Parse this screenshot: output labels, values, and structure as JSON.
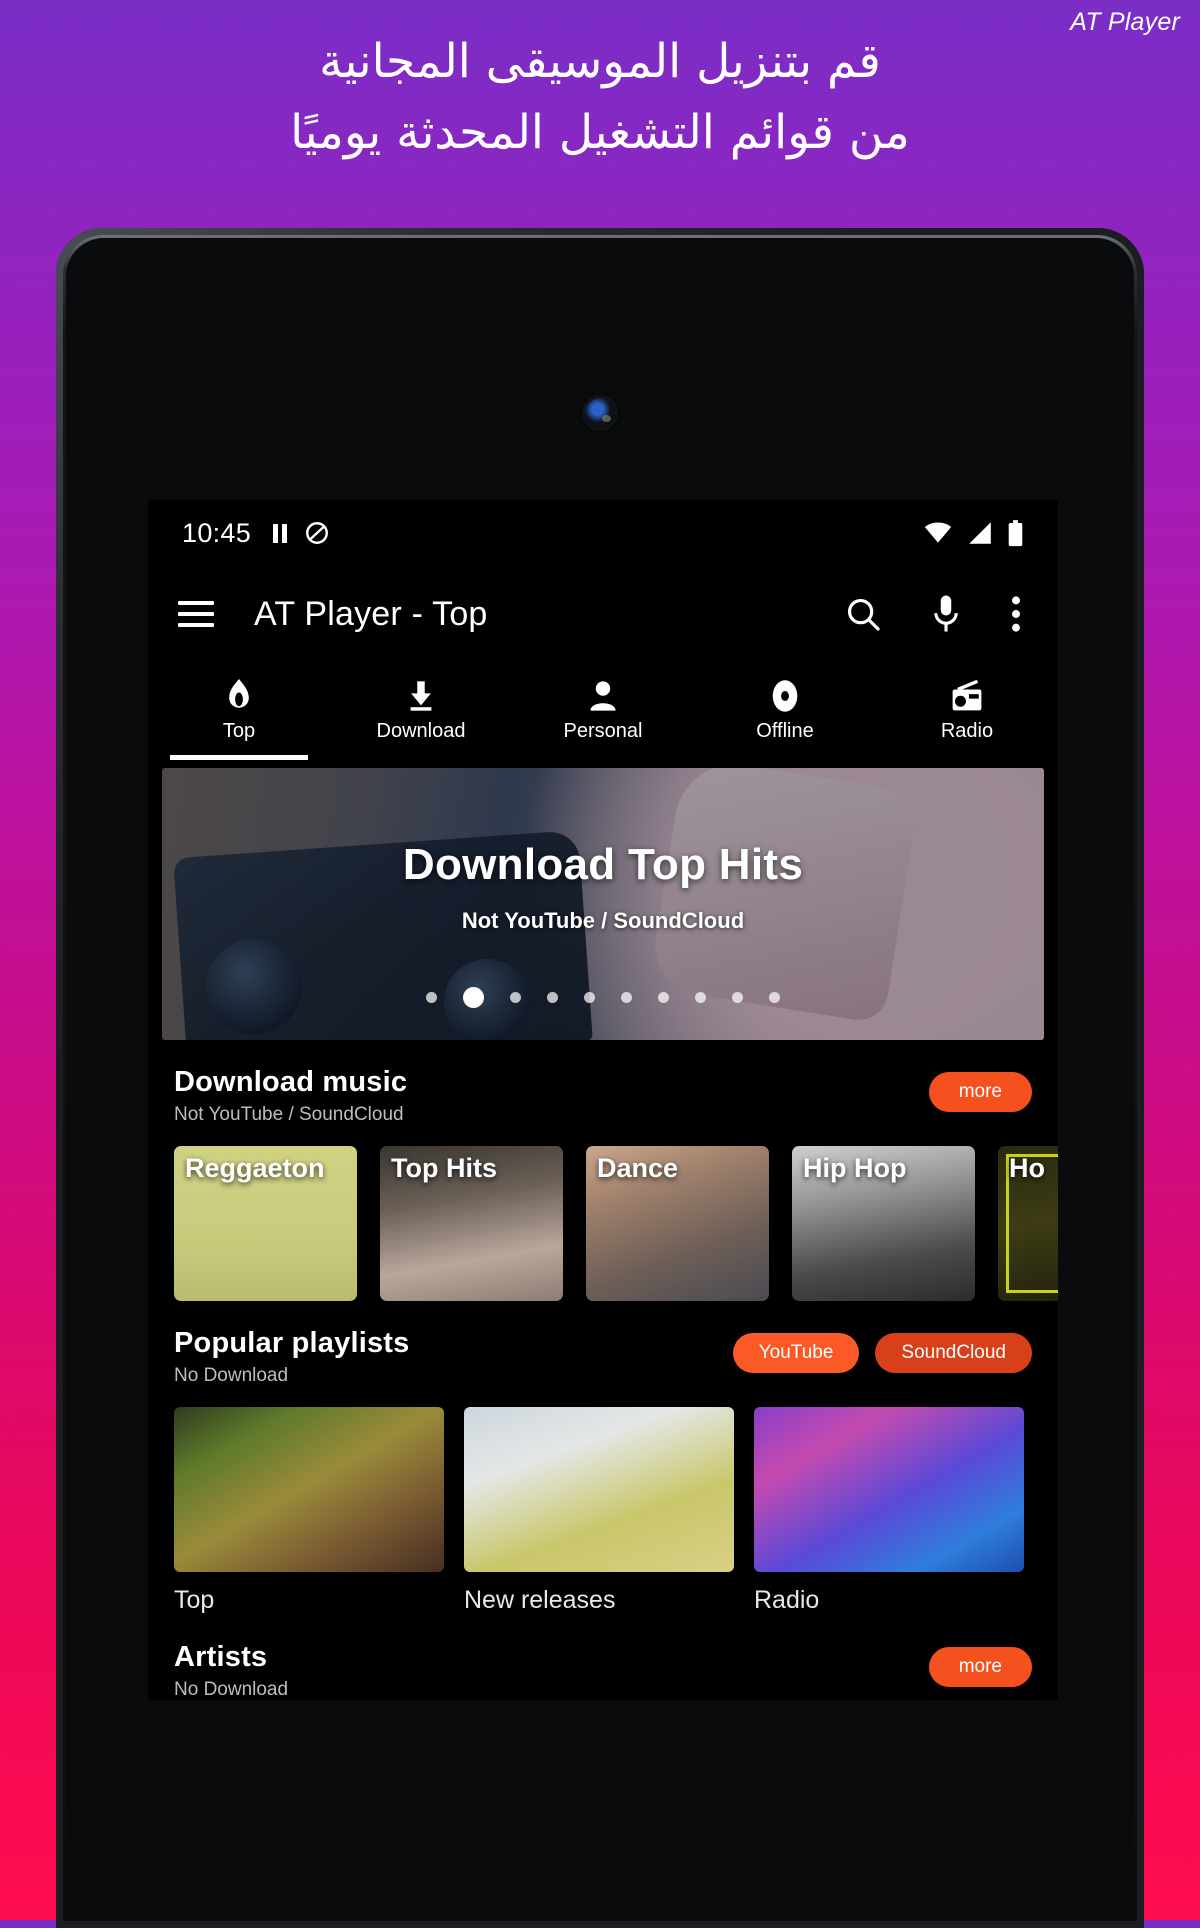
{
  "promo": {
    "brand": "AT Player",
    "headline_line1": "قم بتنزيل الموسيقى المجانية",
    "headline_line2": "من قوائم التشغيل المحدثة يوميًا"
  },
  "statusbar": {
    "time": "10:45",
    "icons": [
      "pause-icon",
      "do-not-disturb-icon",
      "wifi-icon",
      "signal-icon",
      "battery-icon"
    ]
  },
  "appbar": {
    "menu_icon": "hamburger-menu-icon",
    "title": "AT Player - Top",
    "search_icon": "search-icon",
    "mic_icon": "microphone-icon",
    "overflow_icon": "more-vertical-icon"
  },
  "tabs": [
    {
      "label": "Top",
      "icon": "flame-icon",
      "active": true
    },
    {
      "label": "Download",
      "icon": "download-icon",
      "active": false
    },
    {
      "label": "Personal",
      "icon": "person-icon",
      "active": false
    },
    {
      "label": "Offline",
      "icon": "disc-icon",
      "active": false
    },
    {
      "label": "Radio",
      "icon": "radio-icon",
      "active": false
    }
  ],
  "hero": {
    "title": "Download Top Hits",
    "subtitle": "Not YouTube / SoundCloud",
    "dot_count": 10,
    "active_dot": 2
  },
  "sections": {
    "download_music": {
      "title": "Download music",
      "subtitle": "Not YouTube / SoundCloud",
      "more_label": "more",
      "cards": [
        {
          "label": "Reggaeton"
        },
        {
          "label": "Top Hits"
        },
        {
          "label": "Dance"
        },
        {
          "label": "Hip Hop"
        },
        {
          "label": "Ho"
        }
      ]
    },
    "popular_playlists": {
      "title": "Popular playlists",
      "subtitle": "No Download",
      "youtube_label": "YouTube",
      "soundcloud_label": "SoundCloud",
      "cards": [
        {
          "label": "Top"
        },
        {
          "label": "New releases"
        },
        {
          "label": "Radio"
        }
      ]
    },
    "artists": {
      "title": "Artists",
      "subtitle": "No Download",
      "more_label": "more"
    }
  },
  "colors": {
    "accent_orange": "#f4511e",
    "youtube_pill": "#fb5a26",
    "soundcloud_pill": "#d8401a",
    "bg_gradient_top": "#7a2ec6",
    "bg_gradient_bottom": "#fd0c4e",
    "screen_bg": "#000000"
  }
}
